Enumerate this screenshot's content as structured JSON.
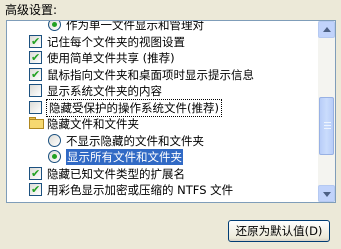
{
  "section_label": "高级设置:",
  "items": [
    {
      "type": "radio",
      "checked": true,
      "indent": 2,
      "label": "作为单一文件显示和管理对"
    },
    {
      "type": "checkbox",
      "checked": true,
      "indent": 1,
      "label": "记住每个文件夹的视图设置"
    },
    {
      "type": "checkbox",
      "checked": true,
      "indent": 1,
      "label": "使用简单文件共享 (推荐)"
    },
    {
      "type": "checkbox",
      "checked": true,
      "indent": 1,
      "label": "鼠标指向文件夹和桌面项时显示提示信息"
    },
    {
      "type": "checkbox",
      "checked": false,
      "indent": 1,
      "label": "显示系统文件夹的内容"
    },
    {
      "type": "checkbox",
      "checked": false,
      "indent": 1,
      "label": "隐藏受保护的操作系统文件(推荐)",
      "state": "focused"
    },
    {
      "type": "folder",
      "indent": 1,
      "label": "隐藏文件和文件夹"
    },
    {
      "type": "radio",
      "checked": false,
      "indent": 2,
      "label": "不显示隐藏的文件和文件夹"
    },
    {
      "type": "radio",
      "checked": true,
      "indent": 2,
      "label": "显示所有文件和文件夹",
      "state": "selected"
    },
    {
      "type": "checkbox",
      "checked": true,
      "indent": 1,
      "label": "隐藏已知文件类型的扩展名"
    },
    {
      "type": "checkbox",
      "checked": true,
      "indent": 1,
      "label": "用彩色显示加密或压缩的 NTFS 文件"
    }
  ],
  "restore_button": {
    "label": "还原为默认值(D)"
  },
  "colors": {
    "selection": "#316ac5",
    "check": "#21a121",
    "frame": "#7f9db9",
    "dialog_bg": "#ece9d8"
  }
}
